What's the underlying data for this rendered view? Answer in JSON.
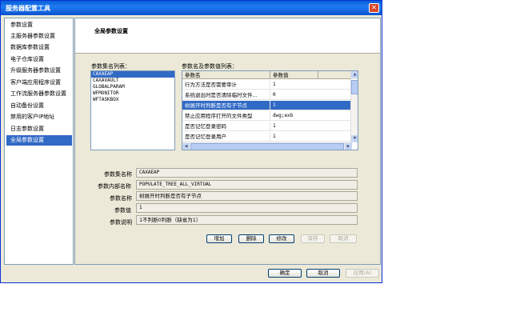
{
  "window": {
    "title": "服务器配置工具"
  },
  "sidebar": {
    "items": [
      {
        "label": "参数设置",
        "selected": false
      },
      {
        "label": "主服务器参数设置",
        "selected": false
      },
      {
        "label": "数据库参数设置",
        "selected": false
      },
      {
        "label": "电子仓库设置",
        "selected": false
      },
      {
        "label": "升级服务器参数设置",
        "selected": false
      },
      {
        "label": "客户端应用程序设置",
        "selected": false
      },
      {
        "label": "工作流服务器参数设置",
        "selected": false
      },
      {
        "label": "自动备份设置",
        "selected": false
      },
      {
        "label": "禁用的客户IP地址",
        "selected": false
      },
      {
        "label": "日志参数设置",
        "selected": false
      },
      {
        "label": "全局参数设置",
        "selected": true
      }
    ]
  },
  "main": {
    "title": "全局参数设置",
    "set_list_label": "参数集名列表：",
    "set_list": [
      {
        "label": "CAXAEAP",
        "selected": true
      },
      {
        "label": "CAXAVAULT",
        "selected": false
      },
      {
        "label": "GLOBALPARAM",
        "selected": false
      },
      {
        "label": "WFMONITOR",
        "selected": false
      },
      {
        "label": "WFTASKBOX",
        "selected": false
      }
    ],
    "param_list_label": "参数名及参数值列表：",
    "param_columns": [
      "参数名",
      "参数值"
    ],
    "params": [
      {
        "name": "行为方法是否需要审计",
        "value": "1",
        "selected": false
      },
      {
        "name": "系统退出时是否清除临时文件...",
        "value": "0",
        "selected": false
      },
      {
        "name": "树展开时判断是否有子节点",
        "value": "1",
        "selected": true
      },
      {
        "name": "禁止应用程序打开的文件类型",
        "value": "dwg;exb",
        "selected": false
      },
      {
        "name": "是否记忆登录密码",
        "value": "1",
        "selected": false
      },
      {
        "name": "是否记忆登录用户",
        "value": "1",
        "selected": false
      }
    ]
  },
  "details": {
    "set_name_label": "参数集名称",
    "set_name_value": "CAXAEAP",
    "internal_name_label": "参数内部名称",
    "internal_name_value": "POPULATE_TREE_ALL_VIRTUAL",
    "param_name_label": "参数名称",
    "param_name_value": "树展开时判断是否有子节点",
    "param_value_label": "参数值",
    "param_value_value": "1",
    "description_label": "参数说明",
    "description_value": "1不判断0判断（缺省为1）"
  },
  "actions": {
    "add": "增加",
    "delete": "删除",
    "modify": "修改",
    "save": "保存",
    "cancel": "取消"
  },
  "footer": {
    "ok": "确定",
    "cancel": "取消",
    "apply": "应用(A)"
  },
  "colors": {
    "selection": "#316ac5",
    "titlebar": "#0a5fd8",
    "dialog_bg": "#ece9d8"
  }
}
